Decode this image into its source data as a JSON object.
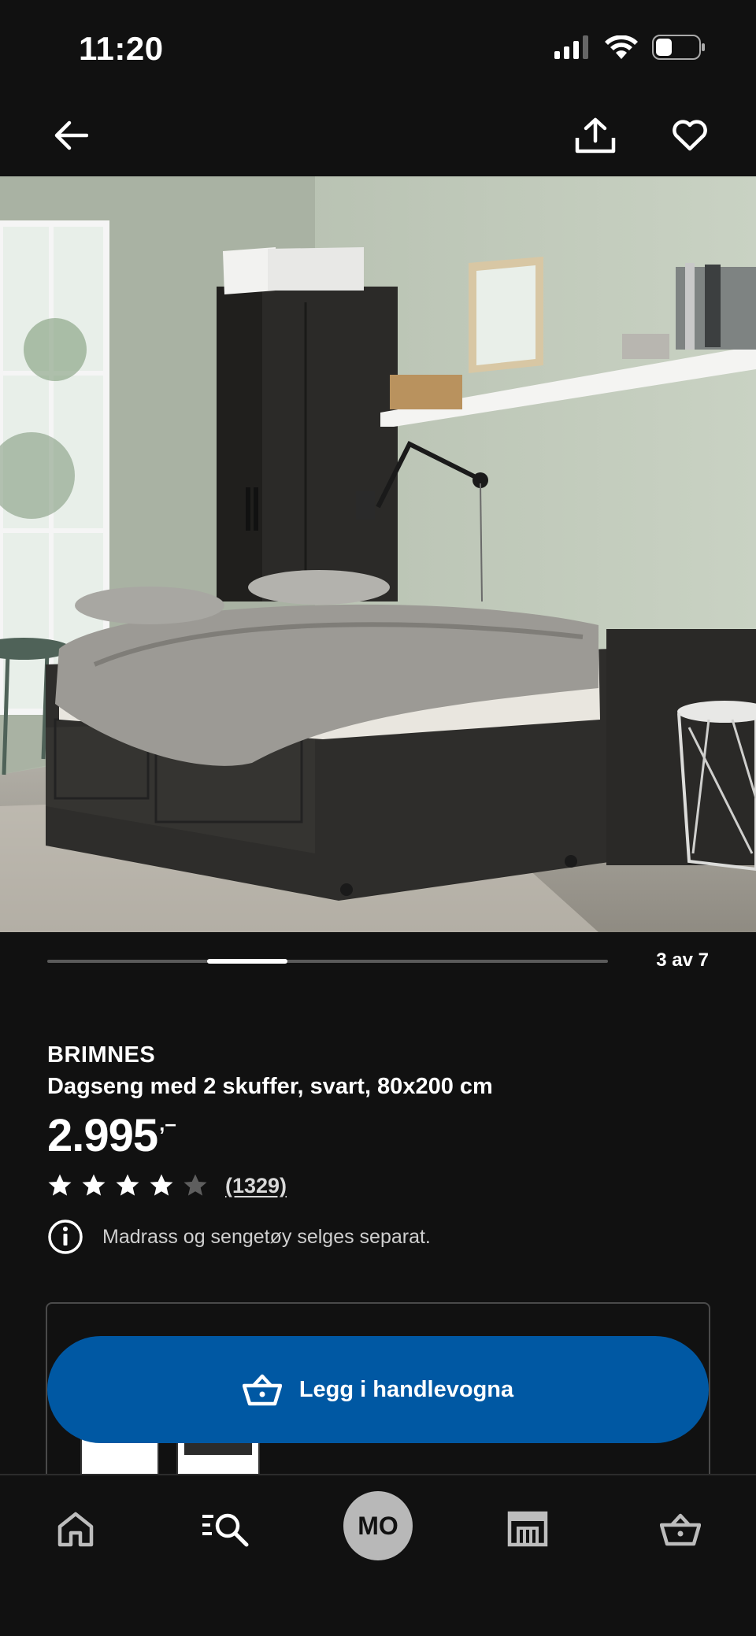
{
  "status_bar": {
    "time": "11:20",
    "icons": [
      "signal-icon",
      "wifi-icon",
      "battery-icon"
    ]
  },
  "top_nav": {
    "icons": [
      "back-arrow-icon",
      "share-icon",
      "heart-icon"
    ]
  },
  "hero_image": {
    "description_icon": "product-photo",
    "current_index": 3,
    "total": 7,
    "progress_fraction_start": 0.2857,
    "progress_fraction_end": 0.4286
  },
  "carousel": {
    "counter": "3 av 7"
  },
  "product": {
    "brand": "BRIMNES",
    "description": "Dagseng med 2 skuffer, svart, 80x200 cm",
    "price": "2.995",
    "price_suffix": ",–",
    "rating_value": 4,
    "rating_max": 5,
    "review_count": "(1329)",
    "notice": "Madrass og sengetøy selges separat."
  },
  "cta": {
    "label": "Legg i handlevogna",
    "icon": "basket-icon"
  },
  "tabbar": {
    "tabs": [
      "home-icon",
      "search-icon",
      "profile-avatar",
      "store-icon",
      "basket-icon"
    ],
    "avatar_initials": "MO"
  },
  "colors": {
    "background": "#111111",
    "cta": "#0058a3",
    "text": "#ffffff",
    "muted": "#cfcfcf"
  }
}
